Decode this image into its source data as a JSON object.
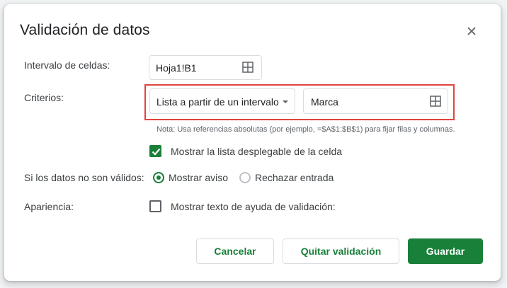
{
  "dialog": {
    "title": "Validación de datos",
    "close_icon": "close-icon"
  },
  "range": {
    "label": "Intervalo de celdas:",
    "value": "Hoja1!B1",
    "icon": "grid-select-icon"
  },
  "criteria": {
    "label": "Criterios:",
    "type_value": "Lista a partir de un intervalo",
    "range_value": "Marca",
    "note": "Nota: Usa referencias absolutas (por ejemplo, =$A$1:$B$1) para fijar filas y columnas.",
    "highlight_color": "#e0453f"
  },
  "dropdown_option": {
    "label": "Mostrar la lista desplegable de la celda",
    "checked": true
  },
  "invalid": {
    "label": "Si los datos no son válidos:",
    "options": [
      {
        "label": "Mostrar aviso",
        "selected": true
      },
      {
        "label": "Rechazar entrada",
        "selected": false
      }
    ]
  },
  "appearance": {
    "label": "Apariencia:",
    "checkbox_label": "Mostrar texto de ayuda de validación:",
    "checked": false
  },
  "buttons": {
    "cancel": "Cancelar",
    "remove": "Quitar validación",
    "save": "Guardar"
  },
  "colors": {
    "accent": "#188038",
    "text": "#3c4043",
    "border": "#dadce0"
  }
}
